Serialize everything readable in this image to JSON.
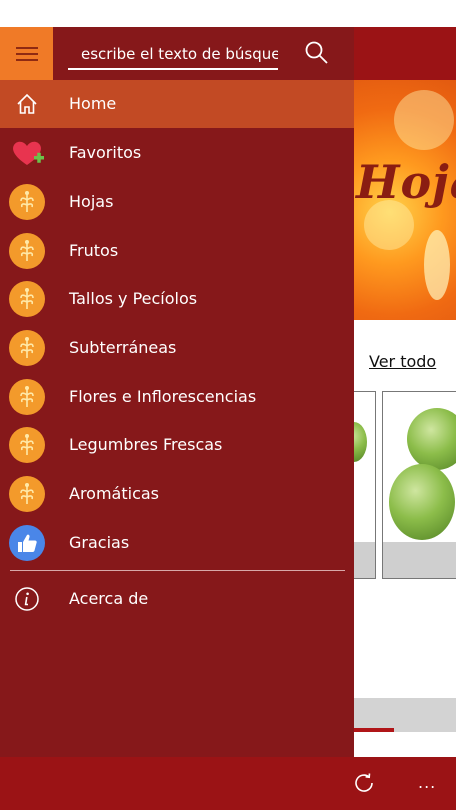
{
  "search": {
    "placeholder": "escribe el texto de búsqueda"
  },
  "menu": {
    "items": [
      {
        "label": "Home",
        "icon": "home-icon"
      },
      {
        "label": "Favoritos",
        "icon": "heart-plus-icon"
      },
      {
        "label": "Hojas",
        "icon": "category-icon"
      },
      {
        "label": "Frutos",
        "icon": "category-icon"
      },
      {
        "label": "Tallos y Pecíolos",
        "icon": "category-icon"
      },
      {
        "label": "Subterráneas",
        "icon": "category-icon"
      },
      {
        "label": "Flores e Inflorescencias",
        "icon": "category-icon"
      },
      {
        "label": "Legumbres Frescas",
        "icon": "category-icon"
      },
      {
        "label": "Aromáticas",
        "icon": "category-icon"
      },
      {
        "label": "Gracias",
        "icon": "thumbs-up-icon"
      }
    ],
    "about": {
      "label": "Acerca de",
      "icon": "info-icon"
    }
  },
  "content": {
    "banner_title": "Hojas",
    "see_all": "Ver todo"
  },
  "bottombar": {
    "more": "..."
  },
  "colors": {
    "brand": "#9b1315",
    "drawer": "#86181a",
    "accent": "#f07a27",
    "active": "#c24a24"
  }
}
